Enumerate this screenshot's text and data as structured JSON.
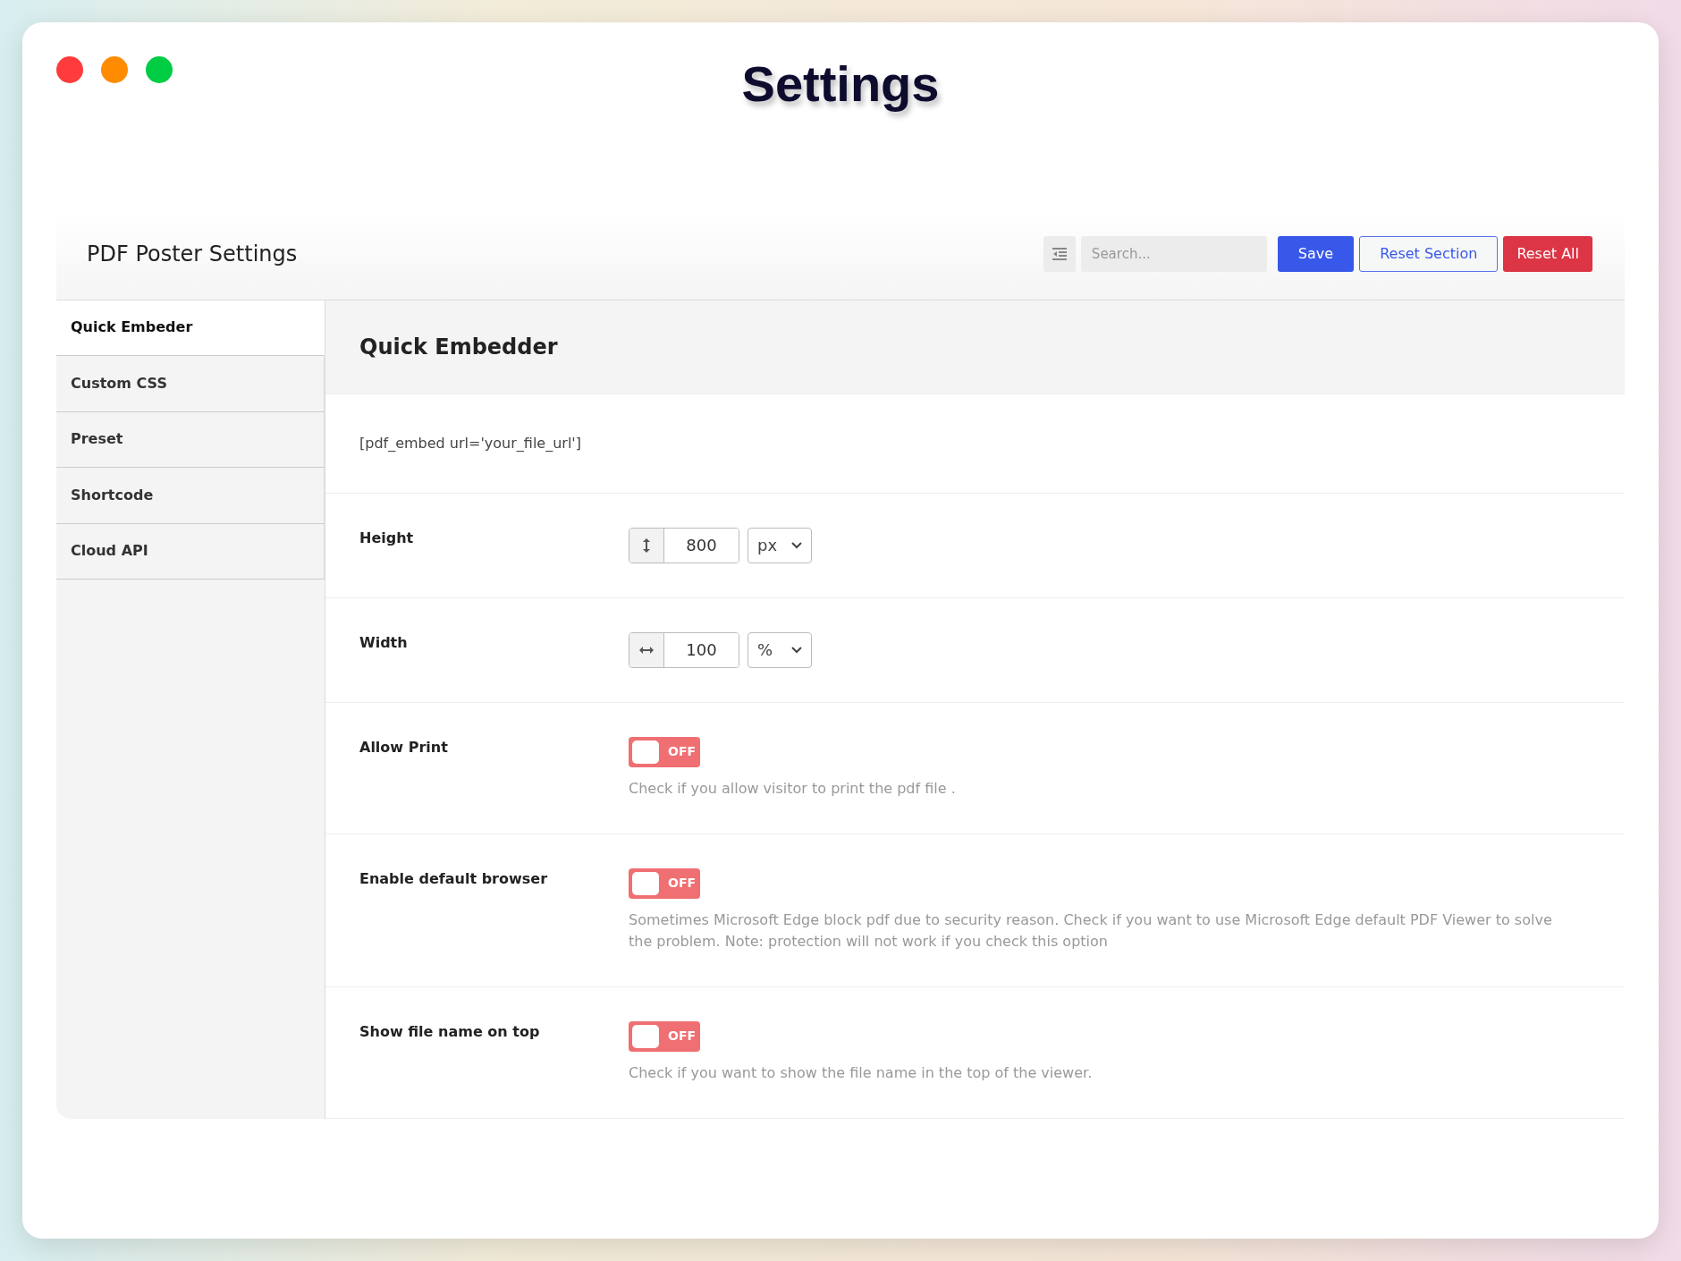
{
  "window": {
    "title": "Settings"
  },
  "panel": {
    "title": "PDF Poster Settings",
    "search": {
      "placeholder": "Search..."
    },
    "buttons": [
      {
        "label": "Save",
        "kind": "primary"
      },
      {
        "label": "Reset Section",
        "kind": "outline"
      },
      {
        "label": "Reset All",
        "kind": "danger"
      }
    ]
  },
  "sidebar": {
    "items": [
      {
        "label": "Quick Embeder",
        "selected": true
      },
      {
        "label": "Custom CSS",
        "selected": false
      },
      {
        "label": "Preset",
        "selected": false
      },
      {
        "label": "Shortcode",
        "selected": false
      },
      {
        "label": "Cloud API",
        "selected": false
      }
    ]
  },
  "section": {
    "title": "Quick Embedder",
    "fields": [
      {
        "kind": "note",
        "text": "[pdf_embed url='your_file_url']"
      },
      {
        "kind": "vertical",
        "label": "Height",
        "value": "800",
        "unit": "px"
      },
      {
        "kind": "horizontal",
        "label": "Width",
        "value": "100",
        "unit": "%"
      },
      {
        "kind": "toggle",
        "label": "Allow Print",
        "on": false,
        "state_label": "OFF",
        "description": "Check if you allow visitor to print the pdf file ."
      },
      {
        "kind": "toggle",
        "label": "Enable default browser",
        "on": false,
        "state_label": "OFF",
        "description": "Sometimes Microsoft Edge block pdf due to security reason. Check if you want to use Microsoft Edge default PDF Viewer to solve the problem. Note: protection will not work if you check this option"
      },
      {
        "kind": "toggle",
        "label": "Show file name on top",
        "on": false,
        "state_label": "OFF",
        "description": "Check if you want to show the file name in the top of the viewer."
      }
    ]
  }
}
